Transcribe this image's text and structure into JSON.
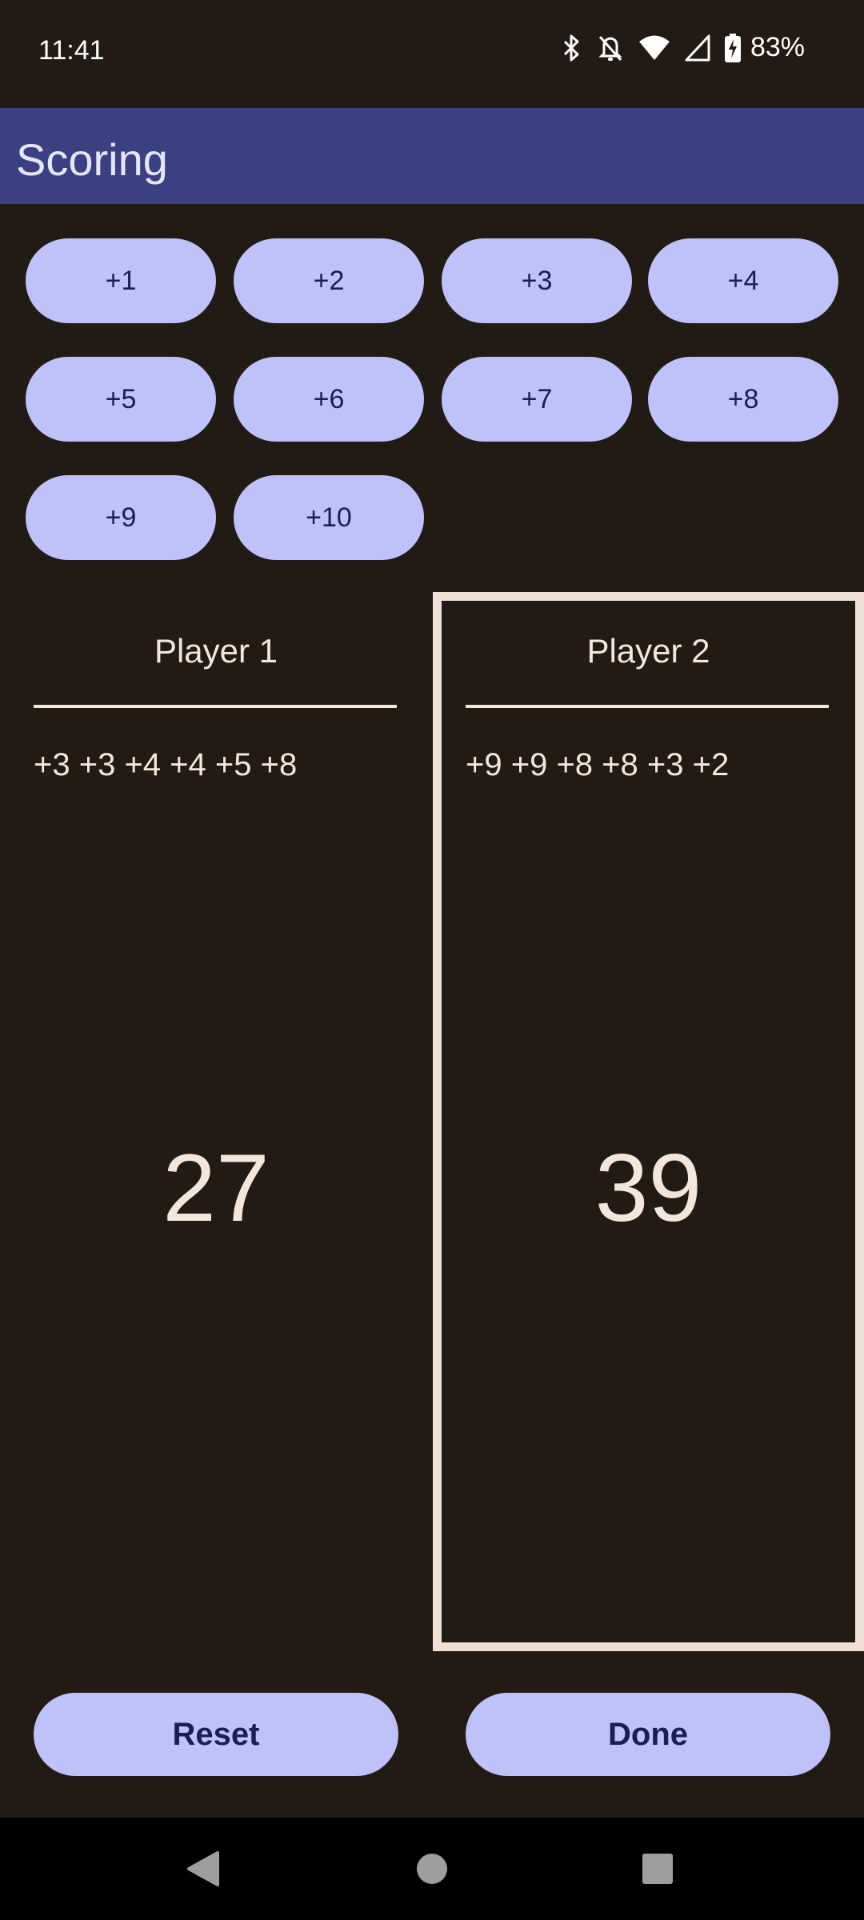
{
  "status_bar": {
    "time": "11:41",
    "battery": "83%",
    "icons": [
      "bluetooth-icon",
      "notifications-off-icon",
      "wifi-icon",
      "cellular-signal-icon",
      "battery-charging-icon"
    ]
  },
  "app_bar": {
    "title": "Scoring"
  },
  "score_buttons": [
    "+1",
    "+2",
    "+3",
    "+4",
    "+5",
    "+6",
    "+7",
    "+8",
    "+9",
    "+10"
  ],
  "players": [
    {
      "name": "Player 1",
      "history": "+3 +3 +4 +4 +5 +8",
      "total": "27",
      "active": false
    },
    {
      "name": "Player 2",
      "history": "+9 +9 +8 +8 +3 +2",
      "total": "39",
      "active": true
    }
  ],
  "actions": {
    "reset_label": "Reset",
    "done_label": "Done"
  },
  "nav_bar": {
    "icons": [
      "back-icon",
      "home-icon",
      "recents-icon"
    ]
  },
  "colors": {
    "background": "#221a15",
    "app_bar": "#3b4180",
    "button": "#bfc2f9",
    "button_text": "#1b1e52",
    "text": "#f3e6da"
  }
}
